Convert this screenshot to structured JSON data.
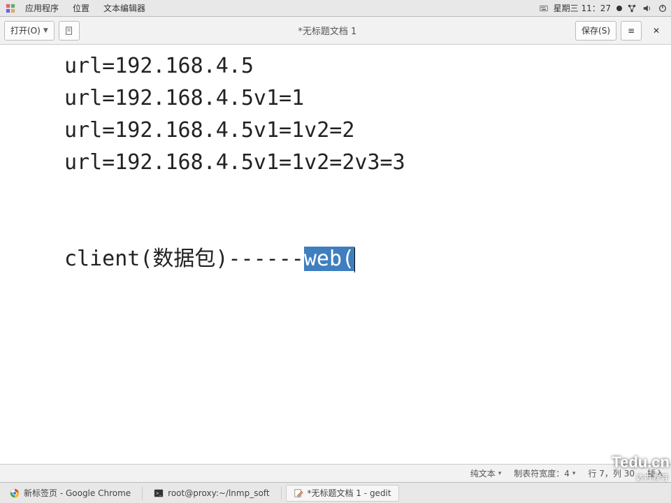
{
  "top_panel": {
    "menus": [
      "应用程序",
      "位置",
      "文本编辑器"
    ],
    "clock": "星期三 11：27"
  },
  "toolbar": {
    "open_label": "打开(O)",
    "title": "*无标题文档 1",
    "save_label": "保存(S)"
  },
  "editor": {
    "lines": [
      "url=192.168.4.5",
      "url=192.168.4.5v1=1",
      "url=192.168.4.5v1=1v2=2",
      "url=192.168.4.5v1=1v2=2v3=3",
      "",
      "",
      ""
    ],
    "line7_prefix": "client(数据包)------",
    "line7_selected": "web(",
    "line7_suffix": ""
  },
  "statusbar": {
    "syntax_label": "纯文本",
    "tabwidth_label": "制表符宽度：4",
    "position": "行 7，列 30",
    "insert_mode": "插入"
  },
  "taskbar": {
    "items": [
      "新标签页 - Google Chrome",
      "root@proxy:~/lnmp_soft",
      "*无标题文档 1 - gedit"
    ]
  },
  "watermark": {
    "big": "Tedu.cn",
    "small": "达内教育"
  }
}
